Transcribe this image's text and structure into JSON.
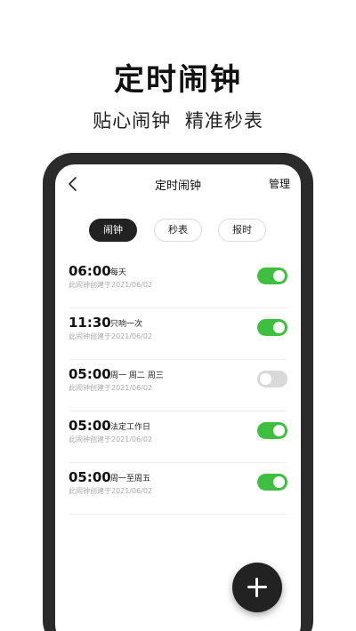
{
  "promo": {
    "title": "定时闹钟",
    "subtitle": "贴心闹钟 精准秒表"
  },
  "nav": {
    "title": "定时闹钟",
    "manage_label": "管理",
    "back_icon": "chevron-left-icon"
  },
  "tabs": [
    {
      "label": "闹钟",
      "active": true
    },
    {
      "label": "秒表",
      "active": false
    },
    {
      "label": "报时",
      "active": false
    }
  ],
  "alarms": [
    {
      "time": "06:00",
      "repeat": "每天",
      "note": "此闹钟创建于2021/06/02",
      "enabled": true
    },
    {
      "time": "11:30",
      "repeat": "只响一次",
      "note": "此闹钟创建于2021/06/02",
      "enabled": true
    },
    {
      "time": "05:00",
      "repeat": "周一 周二 周三",
      "note": "此闹钟创建于2021/06/02",
      "enabled": false
    },
    {
      "time": "05:00",
      "repeat": "法定工作日",
      "note": "此闹钟创建于2021/06/02",
      "enabled": true
    },
    {
      "time": "05:00",
      "repeat": "周一至周五",
      "note": "此闹钟创建于2021/06/02",
      "enabled": true
    }
  ],
  "fab": {
    "icon": "plus-icon"
  },
  "colors": {
    "toggle_on": "#3fbf3f",
    "toggle_off": "#d9d9d9",
    "frame": "#2b2b2b",
    "active_tab": "#222222"
  }
}
